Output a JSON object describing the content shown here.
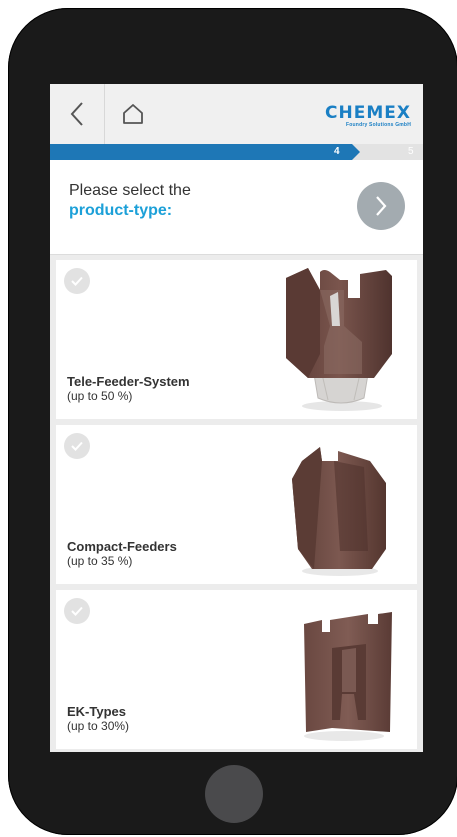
{
  "brand": {
    "name": "CHEMEX",
    "subtitle": "Foundry Solutions GmbH"
  },
  "icons": {
    "back": "chevron-left-icon",
    "home": "home-icon",
    "next": "chevron-right-icon",
    "check": "check-icon"
  },
  "progress": {
    "current_step": "4",
    "next_step": "5"
  },
  "header": {
    "prompt_line1": "Please select the",
    "prompt_line2": "product-type:"
  },
  "products": [
    {
      "title": "Tele-Feeder-System",
      "subtitle": "(up to 50 %)"
    },
    {
      "title": "Compact-Feeders",
      "subtitle": "(up to 35 %)"
    },
    {
      "title": "EK-Types",
      "subtitle": "(up to 30%)"
    }
  ],
  "colors": {
    "accent": "#1ca0d8",
    "progress": "#1e77b6",
    "brand": "#1a7fc4",
    "product": "#6e4a43"
  }
}
